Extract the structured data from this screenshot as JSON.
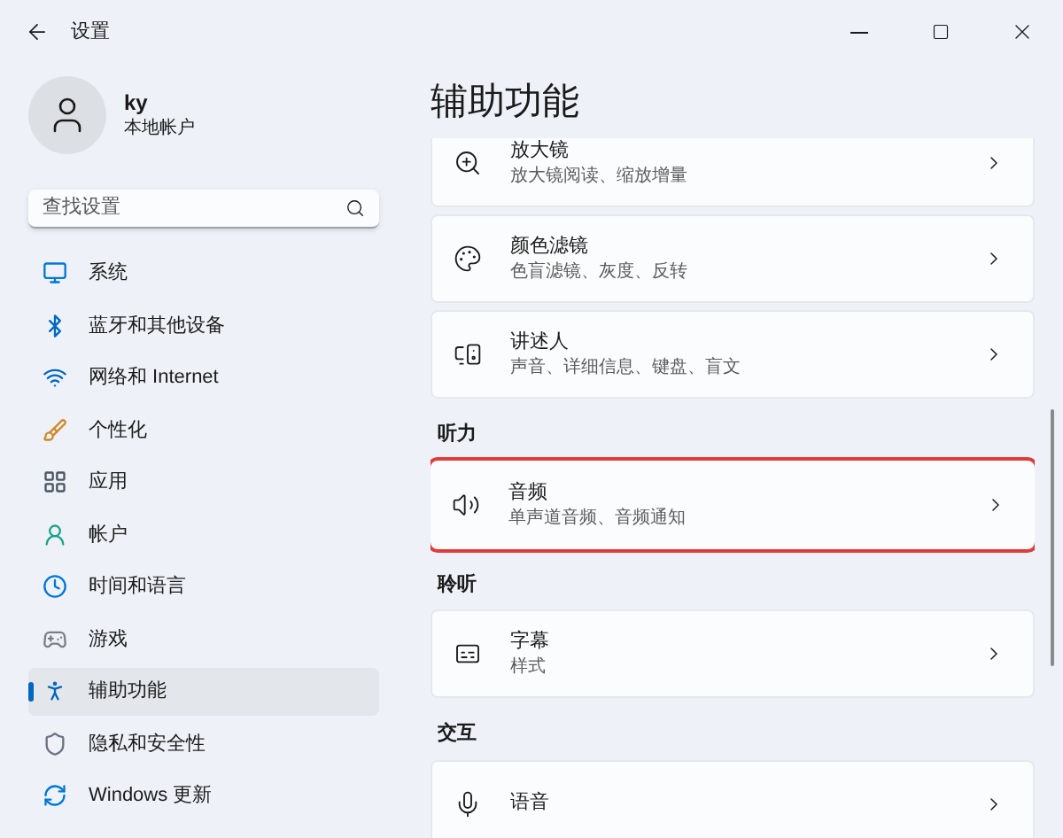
{
  "window": {
    "title": "设置"
  },
  "account": {
    "name": "ky",
    "type": "本地帐户"
  },
  "search": {
    "placeholder": "查找设置"
  },
  "sidebar": {
    "items": [
      {
        "label": "系统",
        "selected": false
      },
      {
        "label": "蓝牙和其他设备",
        "selected": false
      },
      {
        "label": "网络和 Internet",
        "selected": false
      },
      {
        "label": "个性化",
        "selected": false
      },
      {
        "label": "应用",
        "selected": false
      },
      {
        "label": "帐户",
        "selected": false
      },
      {
        "label": "时间和语言",
        "selected": false
      },
      {
        "label": "游戏",
        "selected": false
      },
      {
        "label": "辅助功能",
        "selected": true
      },
      {
        "label": "隐私和安全性",
        "selected": false
      },
      {
        "label": "Windows 更新",
        "selected": false
      }
    ]
  },
  "page": {
    "title": "辅助功能",
    "sections": [
      {
        "cards": [
          {
            "title": "放大镜",
            "subtitle": "放大镜阅读、缩放增量",
            "highlighted": false
          },
          {
            "title": "颜色滤镜",
            "subtitle": "色盲滤镜、灰度、反转",
            "highlighted": false
          },
          {
            "title": "讲述人",
            "subtitle": "声音、详细信息、键盘、盲文",
            "highlighted": false
          }
        ]
      },
      {
        "heading": "听力",
        "cards": [
          {
            "title": "音频",
            "subtitle": "单声道音频、音频通知",
            "highlighted": true
          }
        ]
      },
      {
        "heading": "聆听",
        "cards": [
          {
            "title": "字幕",
            "subtitle": "样式",
            "highlighted": false
          }
        ]
      },
      {
        "heading": "交互",
        "cards": [
          {
            "title": "语音",
            "highlighted": false
          }
        ]
      }
    ]
  }
}
